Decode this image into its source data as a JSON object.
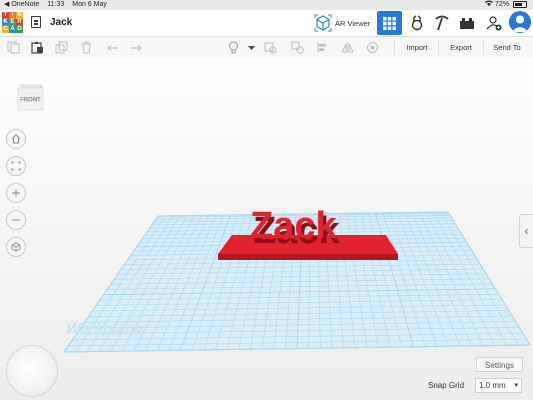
{
  "status_bar": {
    "back_app": "◀ OneNote",
    "time": "11:33",
    "date": "Mon 6 May",
    "battery": "72%",
    "battery_level": 0.72
  },
  "header": {
    "logo_letters": [
      "T",
      "I",
      "N",
      "K",
      "E",
      "R",
      "C",
      "A",
      "D"
    ],
    "logo_colors": [
      "#e23c2d",
      "#f07a1a",
      "#f2b01e",
      "#1b8fd6",
      "#3aa34a",
      "#e23c2d",
      "#f2b01e",
      "#1b8fd6",
      "#3aa34a"
    ],
    "title": "Jack",
    "ar_viewer_label": "AR Viewer",
    "accent": "#2a78d6"
  },
  "toolbar": {
    "import_label": "Import",
    "export_label": "Export",
    "send_to_label": "Send To"
  },
  "viewcube": {
    "face_label": "FRONT"
  },
  "scene": {
    "workplane_label": "Workplane",
    "model_text": "Zack",
    "model_color": "#e0232e",
    "grid_color": "#a9d6ef"
  },
  "settings_label": "Settings",
  "snap_grid": {
    "label": "Snap Grid",
    "value": "1.0 mm"
  }
}
